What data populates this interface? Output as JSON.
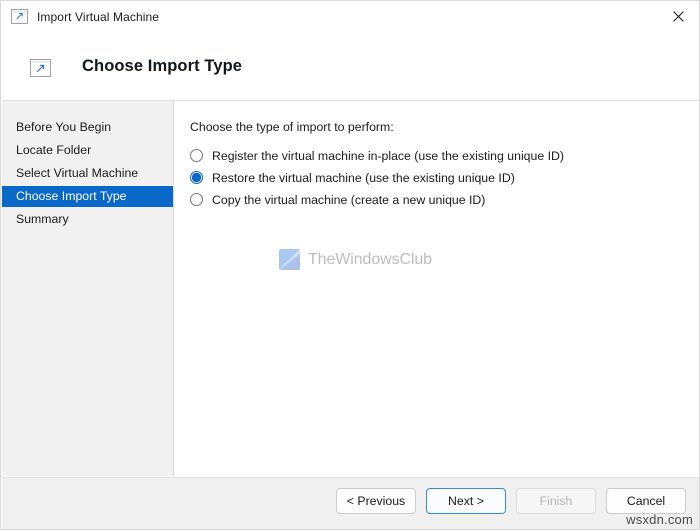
{
  "window": {
    "title": "Import Virtual Machine",
    "title_icon": "virtual-machine-import-icon",
    "close_icon": "close-icon"
  },
  "header": {
    "icon": "virtual-machine-import-icon",
    "title": "Choose Import Type"
  },
  "sidebar": {
    "items": [
      {
        "label": "Before You Begin",
        "selected": false
      },
      {
        "label": "Locate Folder",
        "selected": false
      },
      {
        "label": "Select Virtual Machine",
        "selected": false
      },
      {
        "label": "Choose Import Type",
        "selected": true
      },
      {
        "label": "Summary",
        "selected": false
      }
    ],
    "selected_background": "#0a68c8",
    "background": "#f1f1f1"
  },
  "main": {
    "prompt": "Choose the type of import to perform:",
    "options": [
      {
        "label": "Register the virtual machine in-place (use the existing unique ID)",
        "checked": false
      },
      {
        "label": "Restore the virtual machine (use the existing unique ID)",
        "checked": true
      },
      {
        "label": "Copy the virtual machine (create a new unique ID)",
        "checked": false
      }
    ],
    "accent_color": "#0a68c8"
  },
  "watermark": {
    "text": "TheWindowsClub",
    "logo_icon": "thewindowsclub-logo-icon",
    "color": "#bdbdbd"
  },
  "footer": {
    "buttons": [
      {
        "label": "< Previous",
        "state": "normal"
      },
      {
        "label": "Next >",
        "state": "focused"
      },
      {
        "label": "Finish",
        "state": "disabled"
      },
      {
        "label": "Cancel",
        "state": "normal"
      }
    ]
  },
  "site_watermark": {
    "text": "wsxdn.com"
  }
}
